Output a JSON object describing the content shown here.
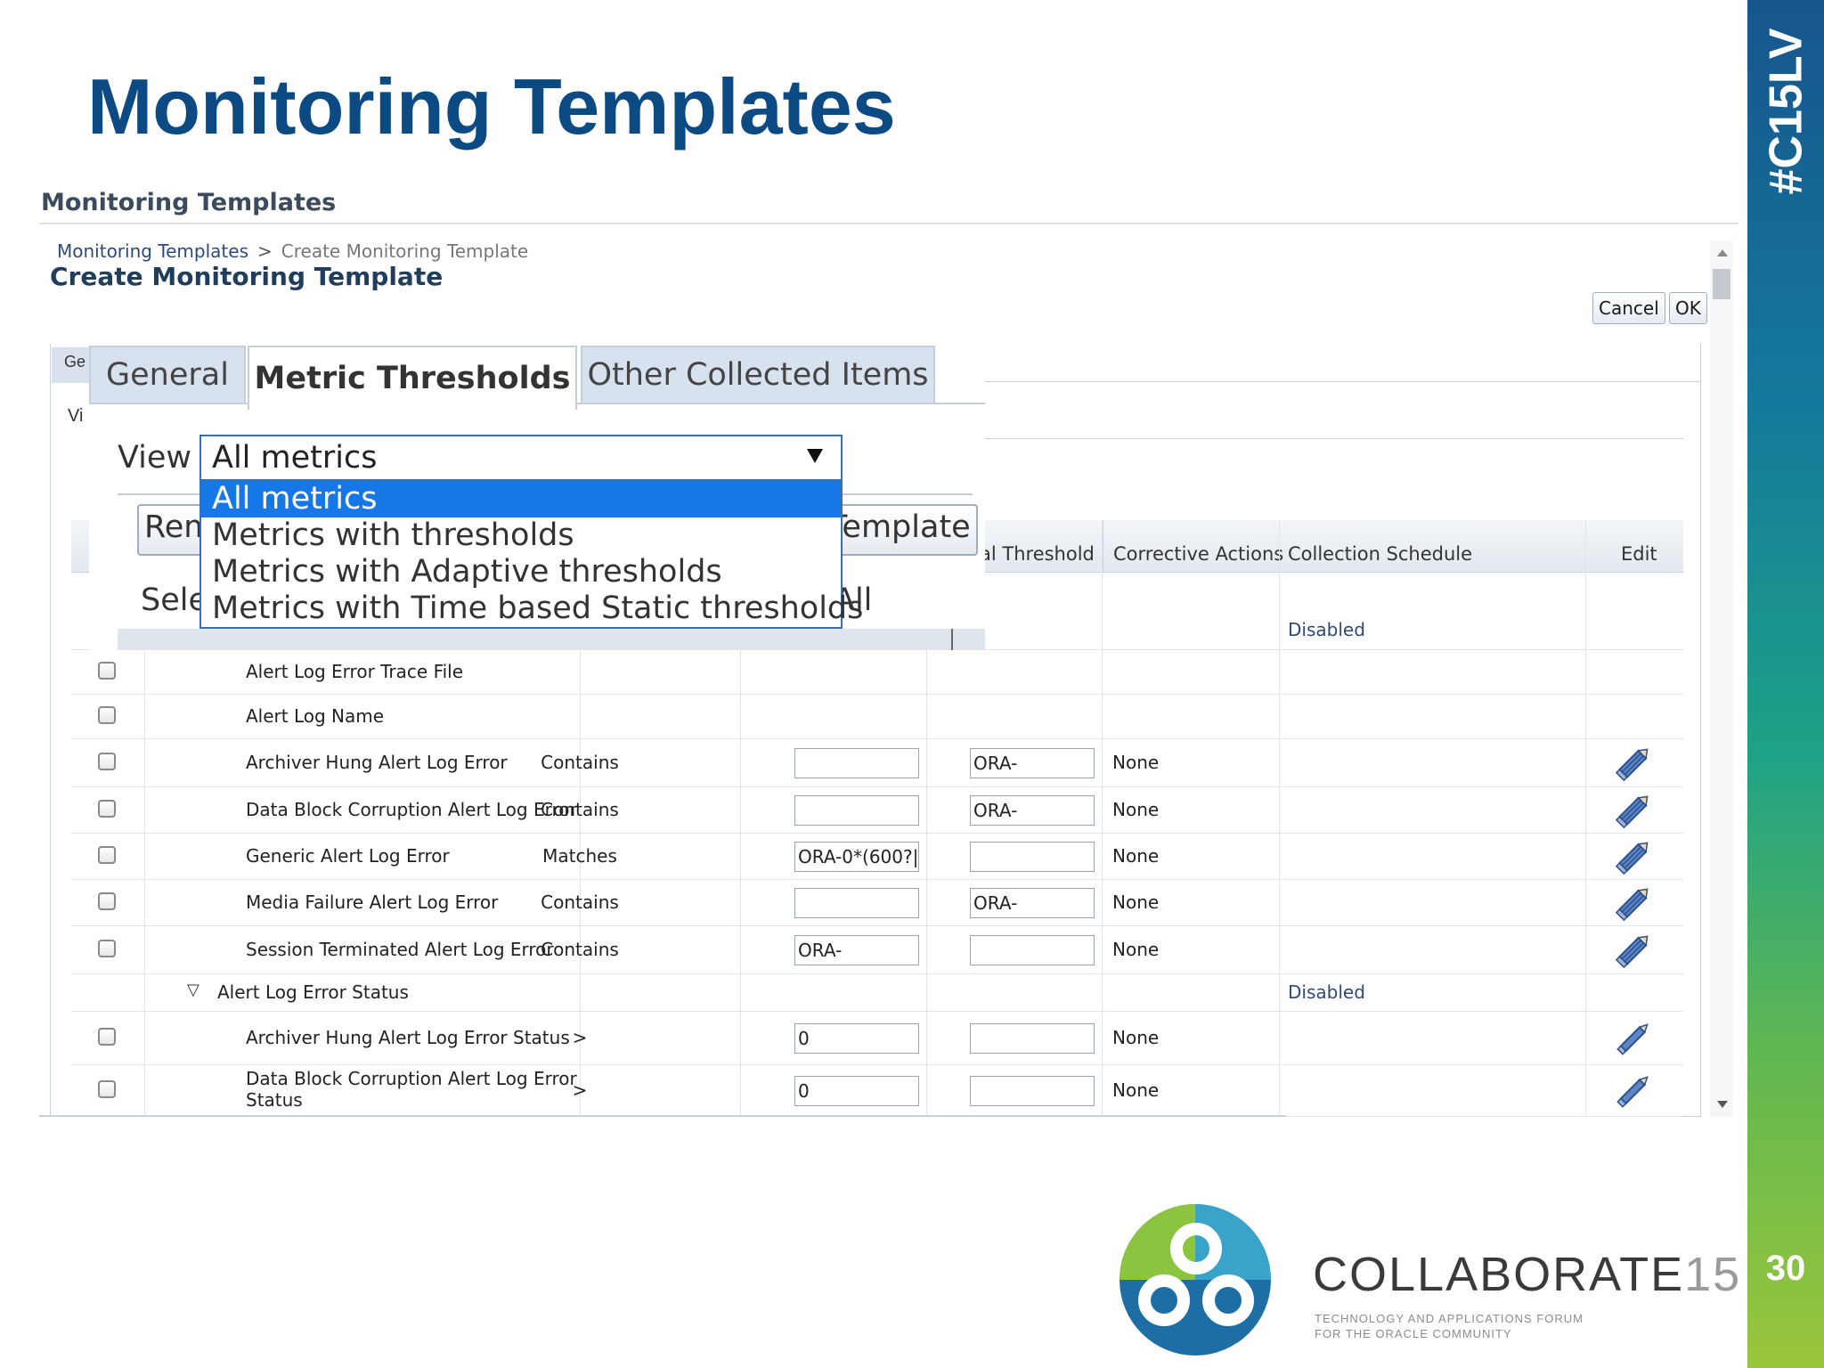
{
  "slide": {
    "title": "Monitoring Templates",
    "hashtag": "#C15LV",
    "page_number": "30",
    "logo_name": "COLLABORATE",
    "logo_num": "15",
    "logo_tagline_1": "TECHNOLOGY AND APPLICATIONS FORUM",
    "logo_tagline_2": "FOR THE ORACLE COMMUNITY",
    "brand_blue": "#0b4a83"
  },
  "screenshot": {
    "header": "Monitoring Templates",
    "breadcrumb": {
      "link": "Monitoring Templates",
      "separator": ">",
      "current": "Create Monitoring Template"
    },
    "page_title": "Create Monitoring Template",
    "buttons": {
      "cancel": "Cancel",
      "ok": "OK"
    },
    "under_tab_fragment": "Ge",
    "under_label_fragment": "Vi",
    "table": {
      "headers": [
        "al Threshold",
        "Corrective Actions",
        "Collection Schedule",
        "Edit"
      ],
      "rows": [
        {
          "type": "status",
          "schedule": "Disabled"
        },
        {
          "type": "item",
          "name": "Alert Log Error Trace File",
          "operator": "",
          "warning": "",
          "critical": "",
          "actions": "",
          "input": false,
          "edit": false
        },
        {
          "type": "item",
          "name": "Alert Log Name",
          "operator": "",
          "warning": "",
          "critical": "",
          "actions": "",
          "input": false,
          "edit": false
        },
        {
          "type": "item",
          "name": "Archiver Hung Alert Log Error",
          "operator": "Contains",
          "warning": "",
          "critical": "ORA-",
          "actions": "None",
          "input": true,
          "edit": true,
          "edit_style": "multi"
        },
        {
          "type": "item",
          "name": "Data Block Corruption Alert Log Error",
          "operator": "Contains",
          "warning": "",
          "critical": "ORA-",
          "actions": "None",
          "input": true,
          "edit": true,
          "edit_style": "multi"
        },
        {
          "type": "item",
          "name": "Generic Alert Log Error",
          "operator": "Matches",
          "warning": "ORA-0*(600?|",
          "critical": "",
          "actions": "None",
          "input": true,
          "edit": true,
          "edit_style": "multi"
        },
        {
          "type": "item",
          "name": "Media Failure Alert Log Error",
          "operator": "Contains",
          "warning": "",
          "critical": "ORA-",
          "actions": "None",
          "input": true,
          "edit": true,
          "edit_style": "multi"
        },
        {
          "type": "item",
          "name": "Session Terminated Alert Log Error",
          "operator": "Contains",
          "warning": "ORA-",
          "critical": "",
          "actions": "None",
          "input": true,
          "edit": true,
          "edit_style": "multi"
        },
        {
          "type": "group",
          "name": "Alert Log Error Status",
          "toggle": "▽",
          "schedule": "Disabled"
        },
        {
          "type": "item",
          "name": "Archiver Hung Alert Log Error Status",
          "operator": ">",
          "warning": "0",
          "critical": "",
          "actions": "None",
          "input": true,
          "edit": true,
          "edit_style": "single"
        },
        {
          "type": "item",
          "name": "Data Block Corruption Alert Log Error",
          "name2": "Status",
          "operator": ">",
          "warning": "0",
          "critical": "",
          "actions": "None",
          "input": true,
          "edit": true,
          "edit_style": "single"
        }
      ]
    }
  },
  "zoom": {
    "tabs": [
      "General",
      "Metric Thresholds",
      "Other Collected Items"
    ],
    "active_tab": 1,
    "view_label": "View",
    "view_value": "All metrics",
    "options": [
      "All metrics",
      "Metrics with thresholds",
      "Metrics with Adaptive thresholds",
      "Metrics with Time based Static thresholds"
    ],
    "selected_option": 0,
    "left_button_fragment": "Rem",
    "right_button_fragment": "Template",
    "select_left_fragment": "Sele",
    "select_right_fragment": "All"
  },
  "icons": {
    "edit": "pencil-edit-icon",
    "dropdown": "triangle-down-icon",
    "scroll_up": "scroll-up-arrow-icon",
    "scroll_down": "scroll-down-arrow-icon"
  }
}
